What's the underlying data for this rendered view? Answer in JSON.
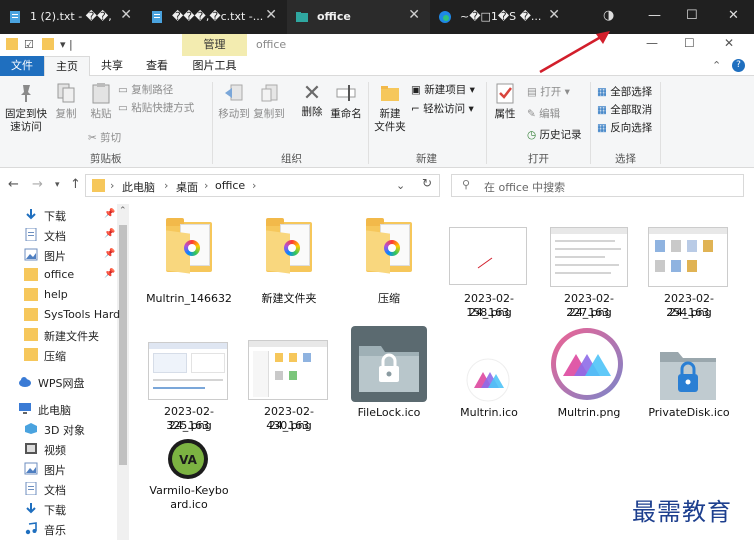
{
  "tabs": [
    {
      "title": "1 (2).txt - ��,",
      "icon": "notepad-icon"
    },
    {
      "title": "���,�c.txt -...",
      "icon": "notepad-icon"
    },
    {
      "title": "office",
      "icon": "folder-icon",
      "active": true
    },
    {
      "title": "~�□1�S �...",
      "icon": "edge-icon"
    }
  ],
  "window_controls": {
    "minimize": "—",
    "maximize": "☐",
    "close": "✕",
    "theme": "◑"
  },
  "titlebar": {
    "context_group": "管理",
    "title": "office"
  },
  "ribbon_tabs": [
    "文件",
    "主页",
    "共享",
    "查看",
    "图片工具"
  ],
  "ribbon": {
    "pin": "固定到快\n速访问",
    "copy": "复制",
    "paste": "粘贴",
    "copy_path": "复制路径",
    "paste_shortcut": "粘贴快捷方式",
    "cut": "剪切",
    "clipboard_group": "剪贴板",
    "move_to": "移动到",
    "copy_to": "复制到",
    "delete": "删除",
    "rename": "重命名",
    "organize_group": "组织",
    "new_folder": "新建\n文件夹",
    "new_item": "新建项目 ▾",
    "easy_access": "轻松访问 ▾",
    "new_group": "新建",
    "properties": "属性",
    "open": "打开 ▾",
    "edit": "编辑",
    "history": "历史记录",
    "open_group": "打开",
    "select_all": "全部选择",
    "select_none": "全部取消",
    "invert": "反向选择",
    "select_group": "选择"
  },
  "address": {
    "crumbs": [
      "此电脑",
      "桌面",
      "office"
    ],
    "search_placeholder": "在 office 中搜索"
  },
  "nav_pane": [
    {
      "label": "下载",
      "icon": "download-icon",
      "pinned": true
    },
    {
      "label": "文档",
      "icon": "document-icon",
      "pinned": true
    },
    {
      "label": "图片",
      "icon": "picture-icon",
      "pinned": true
    },
    {
      "label": "office",
      "icon": "folder-icon",
      "pinned": true
    },
    {
      "label": "help",
      "icon": "folder-icon"
    },
    {
      "label": "SysTools Hard",
      "icon": "folder-icon"
    },
    {
      "label": "新建文件夹",
      "icon": "folder-icon"
    },
    {
      "label": "压缩",
      "icon": "folder-icon"
    },
    {
      "label": "WPS网盘",
      "icon": "cloud-icon"
    },
    {
      "label": "此电脑",
      "icon": "computer-icon"
    },
    {
      "label": "3D 对象",
      "icon": "cube-icon"
    },
    {
      "label": "视频",
      "icon": "video-icon"
    },
    {
      "label": "图片",
      "icon": "picture-icon"
    },
    {
      "label": "文档",
      "icon": "document-icon"
    },
    {
      "label": "下载",
      "icon": "download-icon"
    },
    {
      "label": "音乐",
      "icon": "music-icon"
    }
  ],
  "files": [
    {
      "name": "Multrin_146632",
      "kind": "folder"
    },
    {
      "name": "新建文件夹",
      "kind": "folder"
    },
    {
      "name": "压缩",
      "kind": "folder"
    },
    {
      "name": "2023-02-24_163158.png",
      "kind": "image"
    },
    {
      "name": "2023-02-24_163227.png",
      "kind": "image"
    },
    {
      "name": "2023-02-24_163254.png",
      "kind": "image"
    },
    {
      "name": "2023-02-24_163325.png",
      "kind": "image"
    },
    {
      "name": "2023-02-24_163430.png",
      "kind": "image"
    },
    {
      "name": "FileLock.ico",
      "kind": "icon"
    },
    {
      "name": "Multrin.ico",
      "kind": "icon"
    },
    {
      "name": "Multrin.png",
      "kind": "image"
    },
    {
      "name": "PrivateDisk.ico",
      "kind": "icon"
    },
    {
      "name": "Varmilo-Keyboard.ico",
      "kind": "icon"
    }
  ],
  "file_labels": {
    "f0": "Multrin_146632",
    "f1": "新建文件夹",
    "f2": "压缩",
    "f3a": "2023-02-24_163",
    "f3b": "158.png",
    "f4a": "2023-02-24_163",
    "f4b": "227.png",
    "f5a": "2023-02-24_163",
    "f5b": "254.png",
    "f6a": "2023-02-24_163",
    "f6b": "325.png",
    "f7a": "2023-02-24_163",
    "f7b": "430.png",
    "f8": "FileLock.ico",
    "f9": "Multrin.ico",
    "f10": "Multrin.png",
    "f11": "PrivateDisk.ico",
    "f12a": "Varmilo-Keybo",
    "f12b": "ard.ico"
  },
  "watermark": "最需教育",
  "colors": {
    "accent": "#1f6fbf",
    "tabbar": "#202020",
    "arrow": "#d21e2b"
  }
}
